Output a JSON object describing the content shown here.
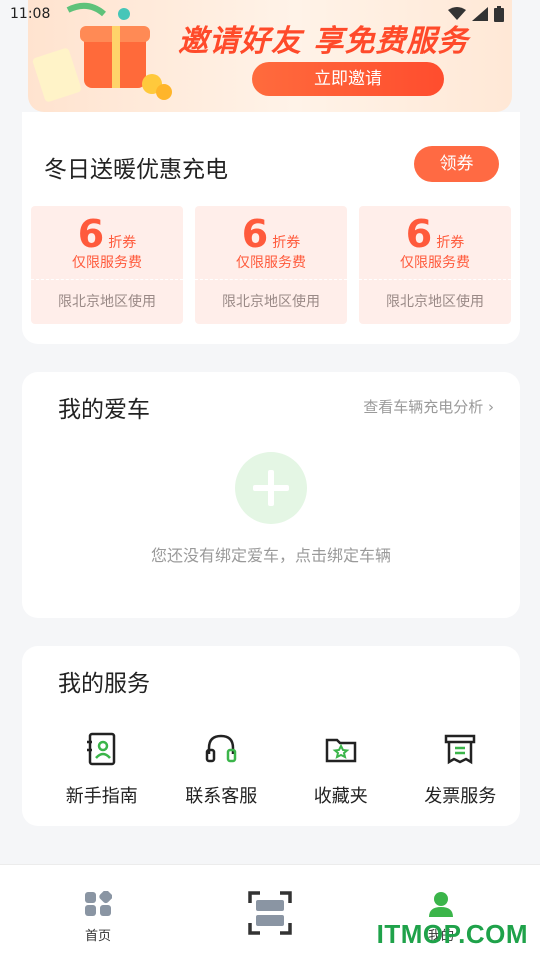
{
  "status_bar": {
    "time": "11:08"
  },
  "banner": {
    "title": "邀请好友 享免费服务",
    "button": "立即邀请"
  },
  "coupon_section": {
    "title": "冬日送暖优惠充电",
    "button": "领券",
    "coupons": [
      {
        "value": "6",
        "unit": "折券",
        "desc": "仅限服务费",
        "region": "限北京地区使用"
      },
      {
        "value": "6",
        "unit": "折券",
        "desc": "仅限服务费",
        "region": "限北京地区使用"
      },
      {
        "value": "6",
        "unit": "折券",
        "desc": "仅限服务费",
        "region": "限北京地区使用"
      }
    ]
  },
  "my_car": {
    "title": "我的爱车",
    "link": "查看车辆充电分析",
    "empty_text": "您还没有绑定爱车，点击绑定车辆"
  },
  "my_services": {
    "title": "我的服务",
    "items": [
      {
        "label": "新手指南",
        "icon": "guide-icon"
      },
      {
        "label": "联系客服",
        "icon": "headset-icon"
      },
      {
        "label": "收藏夹",
        "icon": "favorites-folder-icon"
      },
      {
        "label": "发票服务",
        "icon": "invoice-icon"
      }
    ]
  },
  "tabbar": {
    "home": "首页",
    "scan": "",
    "mine": "我的"
  },
  "watermark": "ITMOP.COM",
  "colors": {
    "accent": "#ff6a43",
    "active_tab": "#3bb54a"
  }
}
